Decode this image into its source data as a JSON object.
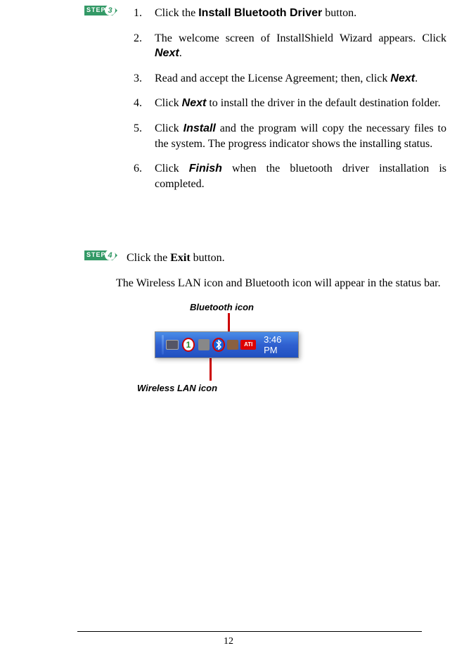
{
  "step3": {
    "badge_label": "STEP",
    "badge_number": "3",
    "items": [
      {
        "num": "1.",
        "pre": "Click the ",
        "bold": "Install Bluetooth Driver",
        "post": " button."
      },
      {
        "num": "2.",
        "pre": "The welcome screen of InstallShield Wizard appears. Click ",
        "bold_it": "Next",
        "post": "."
      },
      {
        "num": "3.",
        "pre": "Read and accept the License Agreement; then, click ",
        "bold_it": "Next",
        "post": "."
      },
      {
        "num": "4.",
        "pre": "Click ",
        "bold_it": "Next",
        "post": " to install the driver in the default destination folder."
      },
      {
        "num": "5.",
        "pre": "Click ",
        "bold_it": "Install",
        "post": " and the program will copy the necessary files to the system.  The progress indicator shows the installing status."
      },
      {
        "num": "6.",
        "pre": "Click ",
        "bold_it": "Finish",
        "post": " when the bluetooth driver installation is completed."
      }
    ]
  },
  "step4": {
    "badge_label": "STEP",
    "badge_number": "4",
    "line1_pre": "Click the ",
    "line1_bold": "Exit",
    "line1_post": " button.",
    "body": "The Wireless LAN icon and Bluetooth icon will appear in the status bar."
  },
  "figure": {
    "bt_label": "Bluetooth icon",
    "wlan_label": "Wireless LAN icon",
    "wlan_text": "1",
    "bt_text": "*",
    "ati_text": "ATI",
    "time_text": "3:46 PM"
  },
  "page_number": "12"
}
